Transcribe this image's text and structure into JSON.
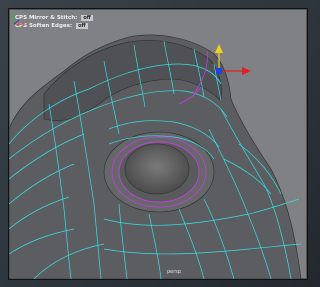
{
  "hud": {
    "row1_label": "CPS Mirror & Stitch:",
    "row1_value": "off",
    "row2_label": "CPS Soften Edges:",
    "row2_value": "off"
  },
  "viewport": {
    "camera_label": "persp",
    "background_color": "#7f8184",
    "wire_color": "#36e0e8",
    "selected_color": "#c040e0"
  },
  "icons": {
    "manipulator": "move-manipulator-icon",
    "axis": "view-axis-icon"
  }
}
